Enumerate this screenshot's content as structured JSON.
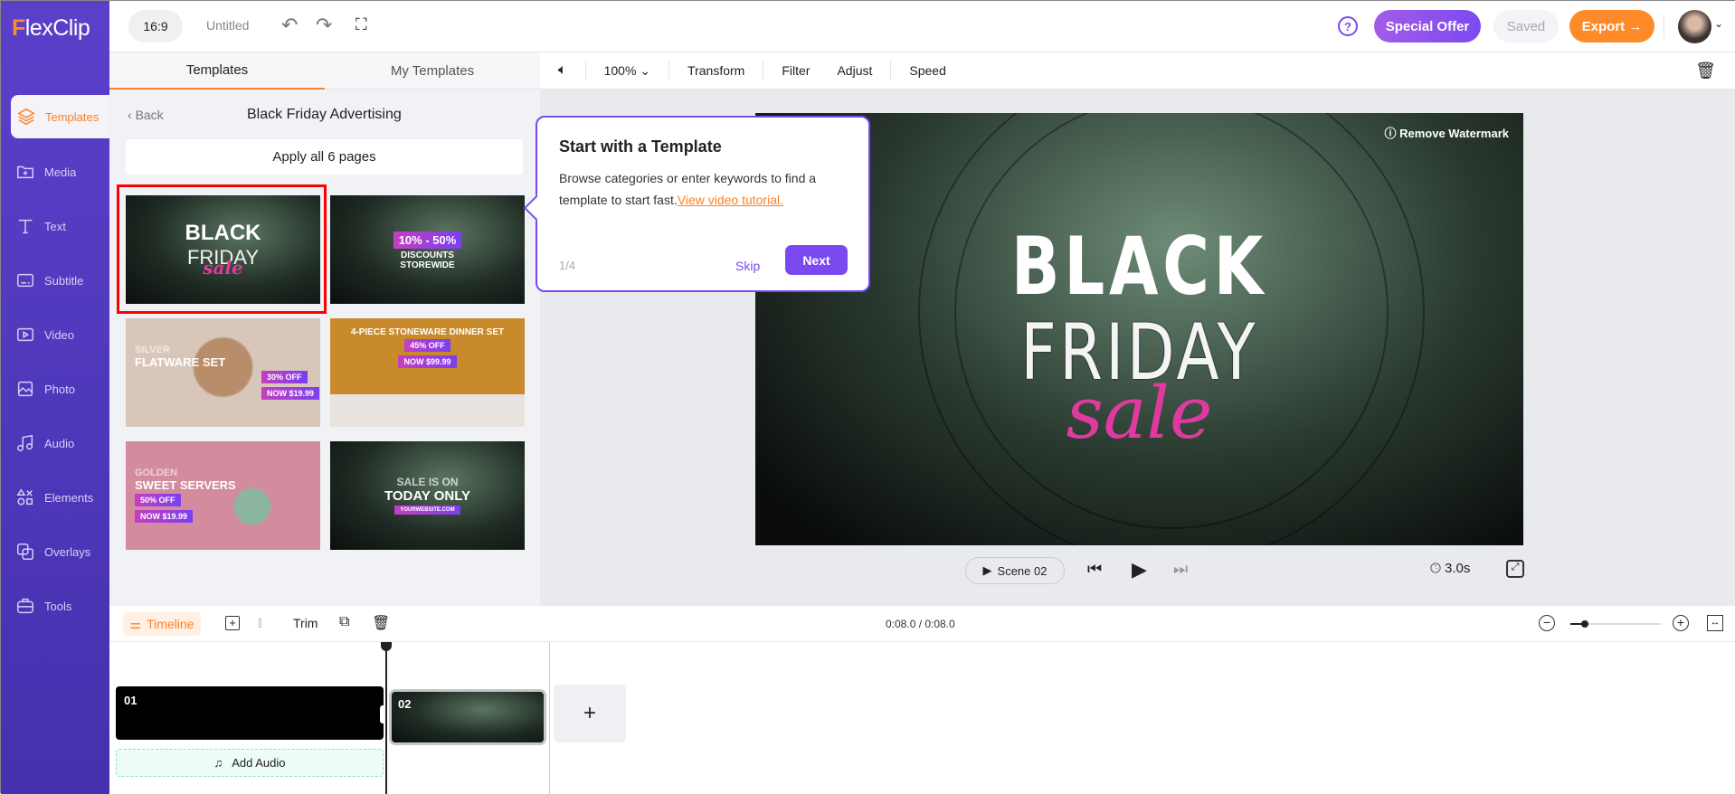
{
  "app": {
    "logo": "FlexClip"
  },
  "topbar": {
    "ratio": "16:9",
    "title": "Untitled",
    "special_offer": "Special Offer",
    "saved": "Saved",
    "export": "Export →"
  },
  "sidebar": {
    "items": [
      {
        "label": "Templates",
        "icon": "layers-icon"
      },
      {
        "label": "Media",
        "icon": "folder-plus-icon"
      },
      {
        "label": "Text",
        "icon": "text-icon"
      },
      {
        "label": "Subtitle",
        "icon": "subtitle-icon"
      },
      {
        "label": "Video",
        "icon": "video-icon"
      },
      {
        "label": "Photo",
        "icon": "photo-icon"
      },
      {
        "label": "Audio",
        "icon": "music-icon"
      },
      {
        "label": "Elements",
        "icon": "shapes-icon"
      },
      {
        "label": "Overlays",
        "icon": "overlays-icon"
      },
      {
        "label": "Tools",
        "icon": "toolbox-icon"
      }
    ]
  },
  "panel": {
    "tabs": [
      "Templates",
      "My Templates"
    ],
    "back": "Back",
    "category": "Black Friday Advertising",
    "apply_all": "Apply all 6 pages",
    "thumbs": [
      {
        "lines": [
          "BLACK",
          "FRIDAY",
          "sale"
        ]
      },
      {
        "lines": [
          "10% - 50%",
          "DISCOUNTS",
          "STOREWIDE"
        ]
      },
      {
        "lines": [
          "SILVER",
          "FLATWARE SET",
          "30% OFF",
          "NOW $19.99"
        ]
      },
      {
        "lines": [
          "4-PIECE STONEWARE DINNER SET",
          "45% OFF",
          "NOW $99.99"
        ]
      },
      {
        "lines": [
          "GOLDEN",
          "SWEET SERVERS",
          "50% OFF",
          "NOW $19.99"
        ]
      },
      {
        "lines": [
          "SALE IS ON",
          "TODAY ONLY",
          "YOURWEBSITE.COM"
        ]
      }
    ]
  },
  "editbar": {
    "zoom": "100%",
    "items": [
      "Transform",
      "Filter",
      "Adjust",
      "Speed"
    ]
  },
  "preview": {
    "watermark": "Remove Watermark",
    "line1": "BLACK",
    "line2": "FRIDAY",
    "line3": "sale",
    "scene": "Scene  02",
    "duration": "3.0s"
  },
  "tooltip": {
    "title": "Start with a Template",
    "body": "Browse categories or enter keywords to find a template to start fast.",
    "link": "View video tutorial.",
    "step": "1/4",
    "skip": "Skip",
    "next": "Next"
  },
  "timeline": {
    "tab": "Timeline",
    "trim": "Trim",
    "time": "0:08.0 / 0:08.0",
    "clips": [
      {
        "num": "01"
      },
      {
        "num": "02"
      }
    ],
    "add_audio": "Add Audio",
    "zoom_level": 0.08
  },
  "colors": {
    "accent": "#ff8024",
    "purple": "#7a4af0",
    "sidebar": "#5a40c9"
  }
}
